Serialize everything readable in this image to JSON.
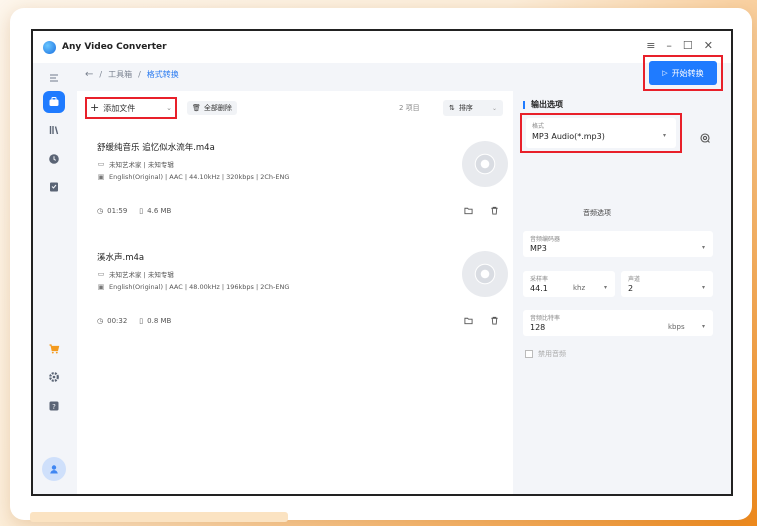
{
  "window": {
    "title": "Any Video Converter",
    "controls": [
      "≡",
      "–",
      "☐",
      "✕"
    ]
  },
  "breadcrumb": {
    "back": "←",
    "sep": "/",
    "parent": "工具箱",
    "current": "格式转换"
  },
  "actions": {
    "start_label": "开始转换"
  },
  "toolbar": {
    "add_label": "添加文件",
    "delete_all_label": "全部删除",
    "item_count": "2 项目",
    "sort_label": "排序"
  },
  "files": [
    {
      "name": "舒缓纯音乐 追忆似水流年.m4a",
      "artist_album": "未知艺术家 | 未知专辑",
      "audio_info": "English(Original) | AAC | 44.10kHz | 320kbps | 2Ch-ENG",
      "duration": "01:59",
      "size": "4.6 MB"
    },
    {
      "name": "溪水声.m4a",
      "artist_album": "未知艺术家 | 未知专辑",
      "audio_info": "English(Original) | AAC | 48.00kHz | 196kbps | 2Ch-ENG",
      "duration": "00:32",
      "size": "0.8 MB"
    }
  ],
  "output": {
    "section_title": "输出选项",
    "format_label": "格式",
    "format_value": "MP3 Audio(*.mp3)",
    "audio_options_title": "音频选项",
    "codec_label": "音频编码器",
    "codec_value": "MP3",
    "sample_rate_label": "采样率",
    "sample_rate_value": "44.1",
    "sample_rate_unit": "khz",
    "channel_label": "声道",
    "channel_value": "2",
    "bitrate_label": "音频比特率",
    "bitrate_value": "128",
    "bitrate_unit": "kbps",
    "disable_audio_label": "禁用音频"
  },
  "colors": {
    "accent": "#1f7bff",
    "highlight": "#e8202a"
  }
}
